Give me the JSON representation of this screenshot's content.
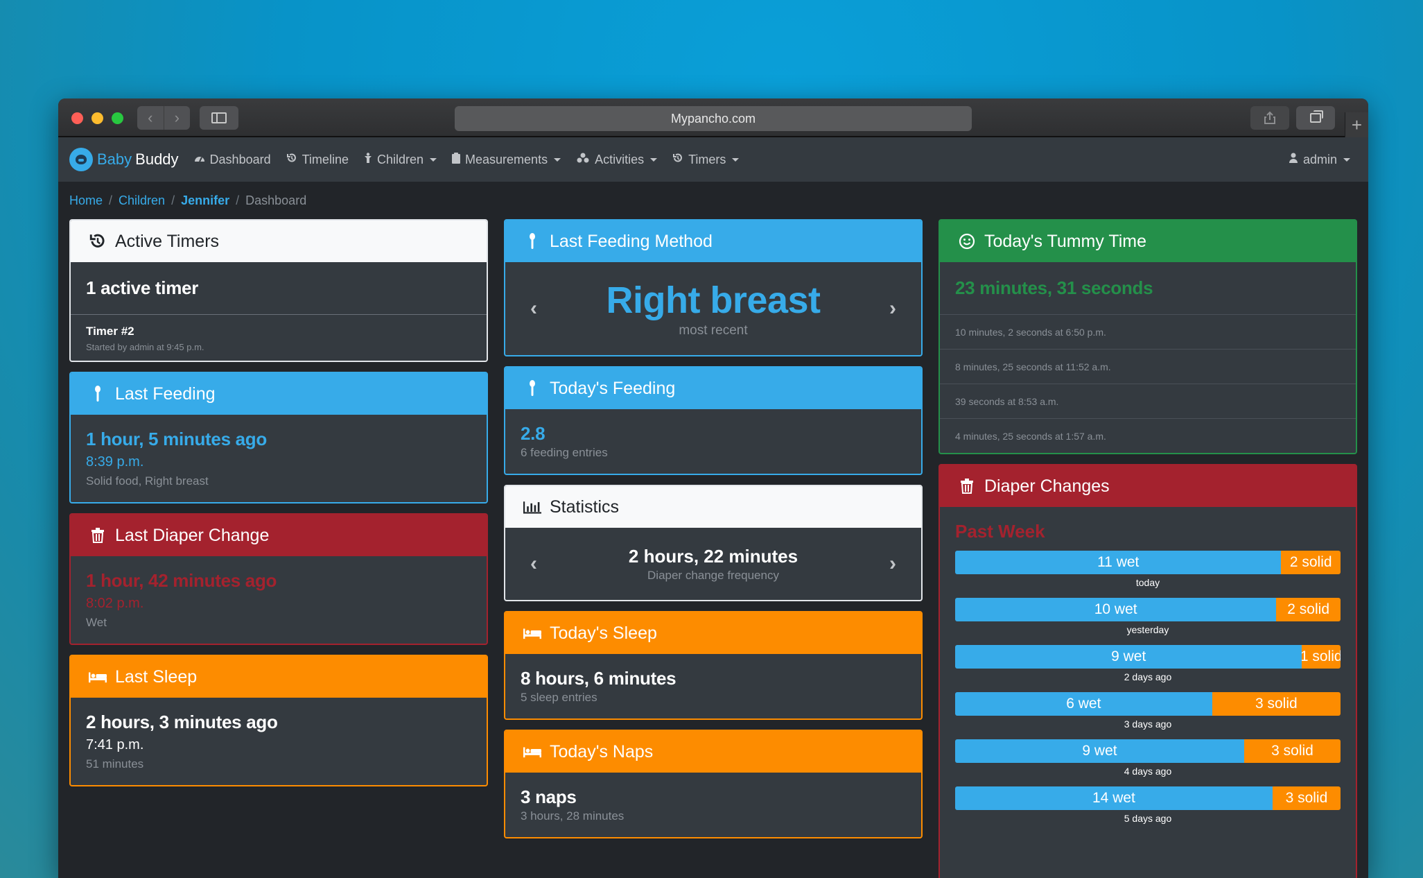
{
  "browser": {
    "url": "Mypancho.com"
  },
  "nav": {
    "brand_baby": "Baby",
    "brand_buddy": "Buddy",
    "items": [
      {
        "label": "Dashboard",
        "icon": "dashboard-icon"
      },
      {
        "label": "Timeline",
        "icon": "history-icon"
      },
      {
        "label": "Children",
        "icon": "child-icon"
      },
      {
        "label": "Measurements",
        "icon": "clipboard-icon"
      },
      {
        "label": "Activities",
        "icon": "activities-icon"
      },
      {
        "label": "Timers",
        "icon": "timer-icon"
      }
    ],
    "user": "admin"
  },
  "breadcrumb": {
    "home": "Home",
    "children": "Children",
    "child": "Jennifer",
    "current": "Dashboard"
  },
  "active_timers": {
    "title": "Active Timers",
    "count": "1 active timer",
    "timer_name": "Timer #2",
    "timer_meta": "Started by admin at 9:45 p.m."
  },
  "last_feeding": {
    "title": "Last Feeding",
    "ago": "1 hour, 5 minutes ago",
    "time": "8:39 p.m.",
    "detail": "Solid food, Right breast"
  },
  "last_diaper": {
    "title": "Last Diaper Change",
    "ago": "1 hour, 42 minutes ago",
    "time": "8:02 p.m.",
    "detail": "Wet"
  },
  "last_sleep": {
    "title": "Last Sleep",
    "ago": "2 hours, 3 minutes ago",
    "time": "7:41 p.m.",
    "detail": "51 minutes"
  },
  "last_feeding_method": {
    "title": "Last Feeding Method",
    "value": "Right breast",
    "sub": "most recent"
  },
  "todays_feeding": {
    "title": "Today's Feeding",
    "value": "2.8",
    "sub": "6 feeding entries"
  },
  "statistics": {
    "title": "Statistics",
    "value": "2 hours, 22 minutes",
    "sub": "Diaper change frequency"
  },
  "todays_sleep": {
    "title": "Today's Sleep",
    "value": "8 hours, 6 minutes",
    "sub": "5 sleep entries"
  },
  "todays_naps": {
    "title": "Today's Naps",
    "value": "3 naps",
    "sub": "3 hours, 28 minutes"
  },
  "tummy_time": {
    "title": "Today's Tummy Time",
    "total": "23 minutes, 31 seconds",
    "entries": [
      "10 minutes, 2 seconds at 6:50 p.m.",
      "8 minutes, 25 seconds at 11:52 a.m.",
      "39 seconds at 8:53 a.m.",
      "4 minutes, 25 seconds at 1:57 a.m."
    ]
  },
  "diaper_changes": {
    "title": "Diaper Changes",
    "subtitle": "Past Week",
    "colors": {
      "wet": "#37abe9",
      "solid": "#fd8c00"
    },
    "days": [
      {
        "label": "today",
        "wet": 11,
        "solid": 2,
        "wet_text": "11 wet",
        "solid_text": "2 solid"
      },
      {
        "label": "yesterday",
        "wet": 10,
        "solid": 2,
        "wet_text": "10 wet",
        "solid_text": "2 solid"
      },
      {
        "label": "2 days ago",
        "wet": 9,
        "solid": 1,
        "wet_text": "9 wet",
        "solid_text": "1 solid"
      },
      {
        "label": "3 days ago",
        "wet": 6,
        "solid": 3,
        "wet_text": "6 wet",
        "solid_text": "3 solid"
      },
      {
        "label": "4 days ago",
        "wet": 9,
        "solid": 3,
        "wet_text": "9 wet",
        "solid_text": "3 solid"
      },
      {
        "label": "5 days ago",
        "wet": 14,
        "solid": 3,
        "wet_text": "14 wet",
        "solid_text": "3 solid"
      }
    ]
  }
}
